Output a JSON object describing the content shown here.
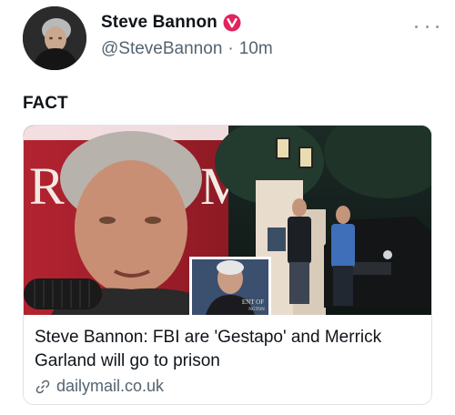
{
  "post": {
    "author": {
      "display_name": "Steve Bannon",
      "handle": "@SteveBannon",
      "time_separator": "·",
      "time_ago": "10m",
      "avatar_icon": "avatar",
      "verified_icon": "verified-badge-icon"
    },
    "more_icon": "more-icon",
    "text": "FACT",
    "link_card": {
      "image_caption_fragment": "ENT OF",
      "image_caption_fragment_2": "NGTON",
      "image_letter": "R",
      "image_letter_2": "M",
      "title": "Steve Bannon: FBI are 'Gestapo' and Merrick Garland will go to prison",
      "domain": "dailymail.co.uk",
      "link_icon": "link-icon"
    }
  },
  "colors": {
    "text": "#0f1419",
    "secondary": "#536471",
    "verified": "#e0245e",
    "card_border": "#dfe3e6"
  }
}
